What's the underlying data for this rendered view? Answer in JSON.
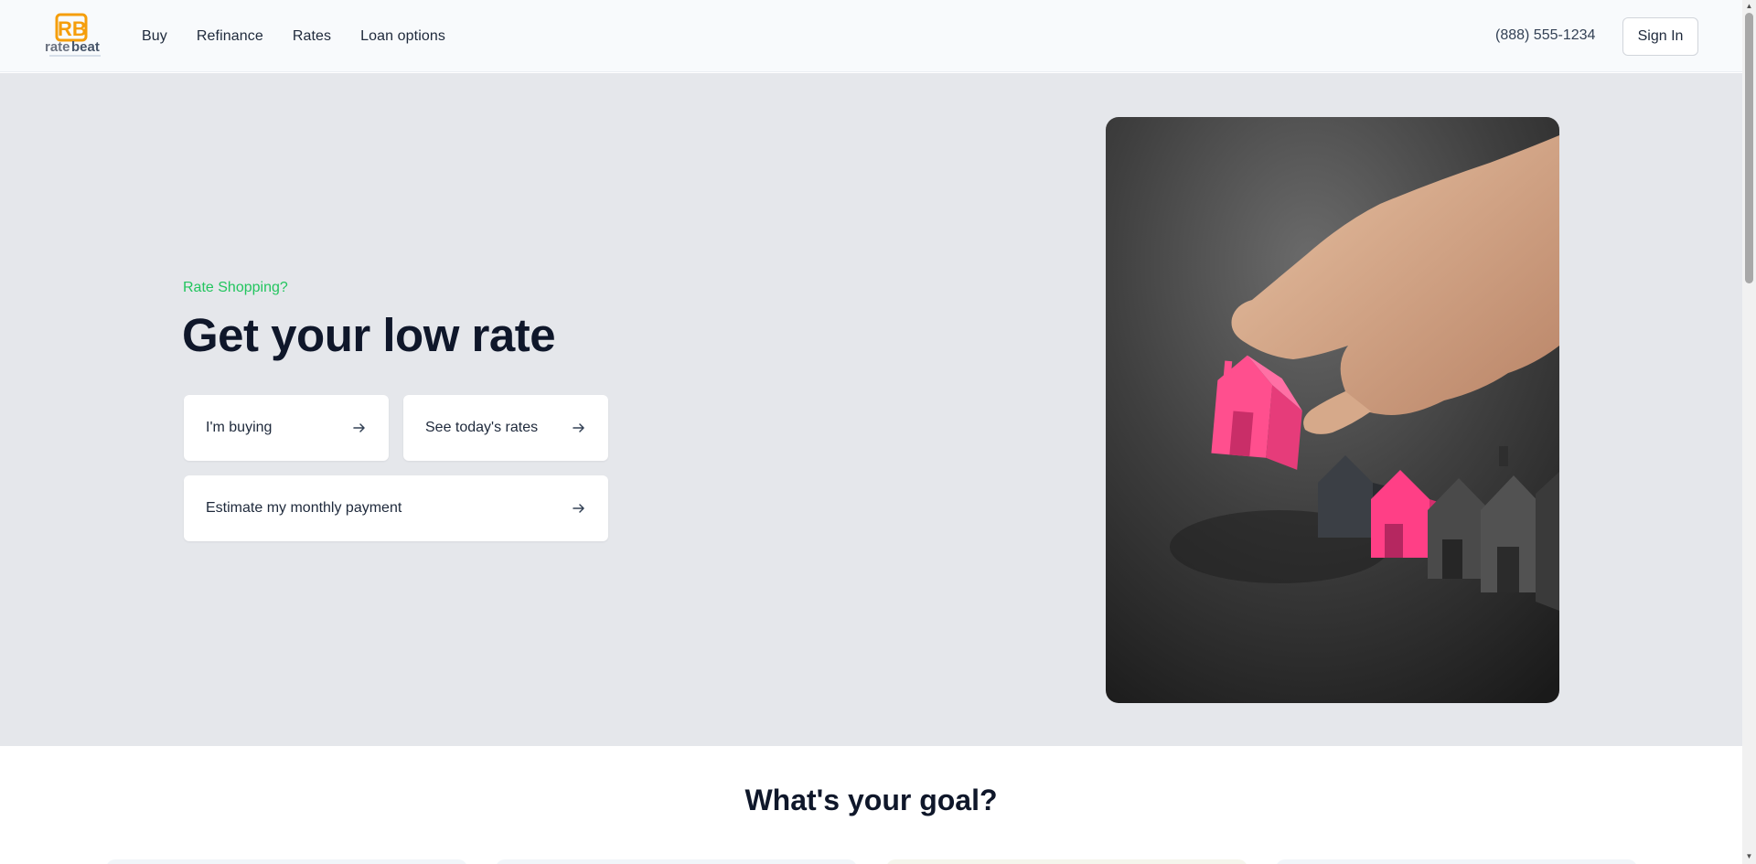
{
  "brand": {
    "logo_text": "ratebeat",
    "logo_letters": "RB",
    "primary_color": "#f59e0b"
  },
  "nav": {
    "items": [
      "Buy",
      "Refinance",
      "Rates",
      "Loan options"
    ]
  },
  "header": {
    "phone": "(888) 555-1234",
    "signin_label": "Sign In"
  },
  "hero": {
    "eyebrow": "Rate Shopping?",
    "headline": "Get your low rate",
    "actions": [
      {
        "label": "I'm buying",
        "icon": "arrow-right-icon"
      },
      {
        "label": "See today's rates",
        "icon": "arrow-right-icon"
      },
      {
        "label": "Estimate my monthly payment",
        "icon": "arrow-right-icon"
      }
    ],
    "eyebrow_color": "#22c55e"
  },
  "goal": {
    "title": "What's your goal?"
  }
}
